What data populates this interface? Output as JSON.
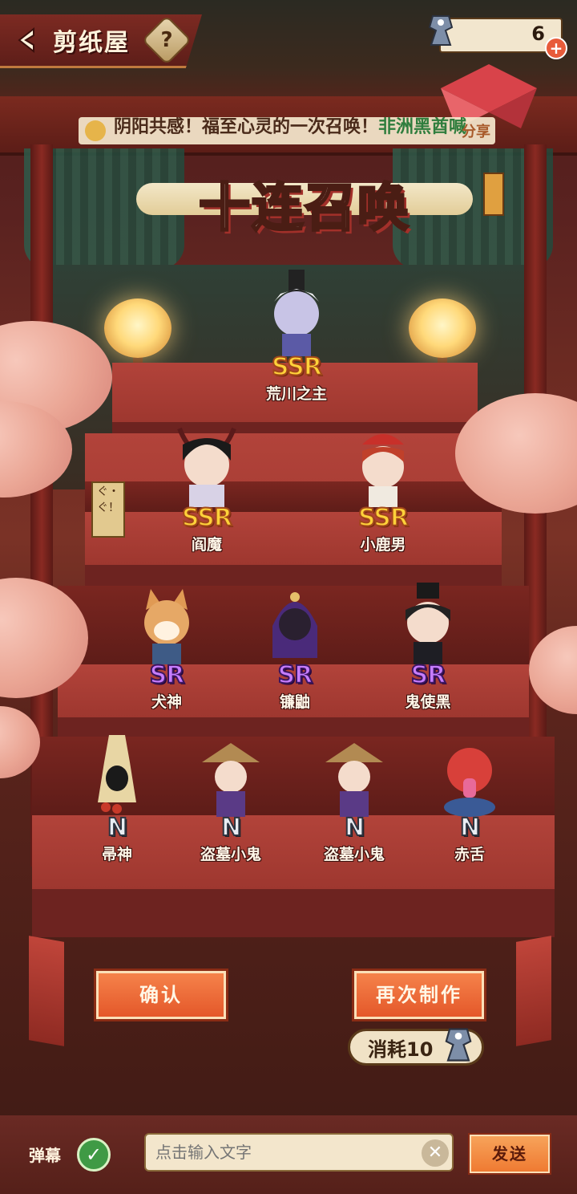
{
  "header": {
    "title": "剪纸屋",
    "help_label": "?",
    "currency_value": "6",
    "plus_label": "+"
  },
  "marquee": {
    "text_lead": "阴阳共感！福至心灵的一次召唤！",
    "text_highlight": "非洲黑酋喊",
    "tag": "分享"
  },
  "banner": {
    "title": "十连召唤"
  },
  "characters": [
    {
      "rarity": "SSR",
      "name": "荒川之主"
    },
    {
      "rarity": "SSR",
      "name": "阎魔"
    },
    {
      "rarity": "SSR",
      "name": "小鹿男"
    },
    {
      "rarity": "SR",
      "name": "犬神"
    },
    {
      "rarity": "SR",
      "name": "镰鼬"
    },
    {
      "rarity": "SR",
      "name": "鬼使黑"
    },
    {
      "rarity": "N",
      "name": "帚神"
    },
    {
      "rarity": "N",
      "name": "盗墓小鬼"
    },
    {
      "rarity": "N",
      "name": "盗墓小鬼"
    },
    {
      "rarity": "N",
      "name": "赤舌"
    }
  ],
  "sign_text": "ぐ・ぐ！",
  "actions": {
    "confirm_label": "确认",
    "again_label": "再次制作",
    "cost_label": "消耗10"
  },
  "chat": {
    "danmu_label": "弹幕",
    "input_placeholder": "点击输入文字",
    "send_label": "发送"
  },
  "colors": {
    "ssr": "#ffd23a",
    "sr": "#c77dff",
    "n": "#e8ecf2",
    "button": "#e4582a",
    "stair_red": "#b2433a"
  }
}
